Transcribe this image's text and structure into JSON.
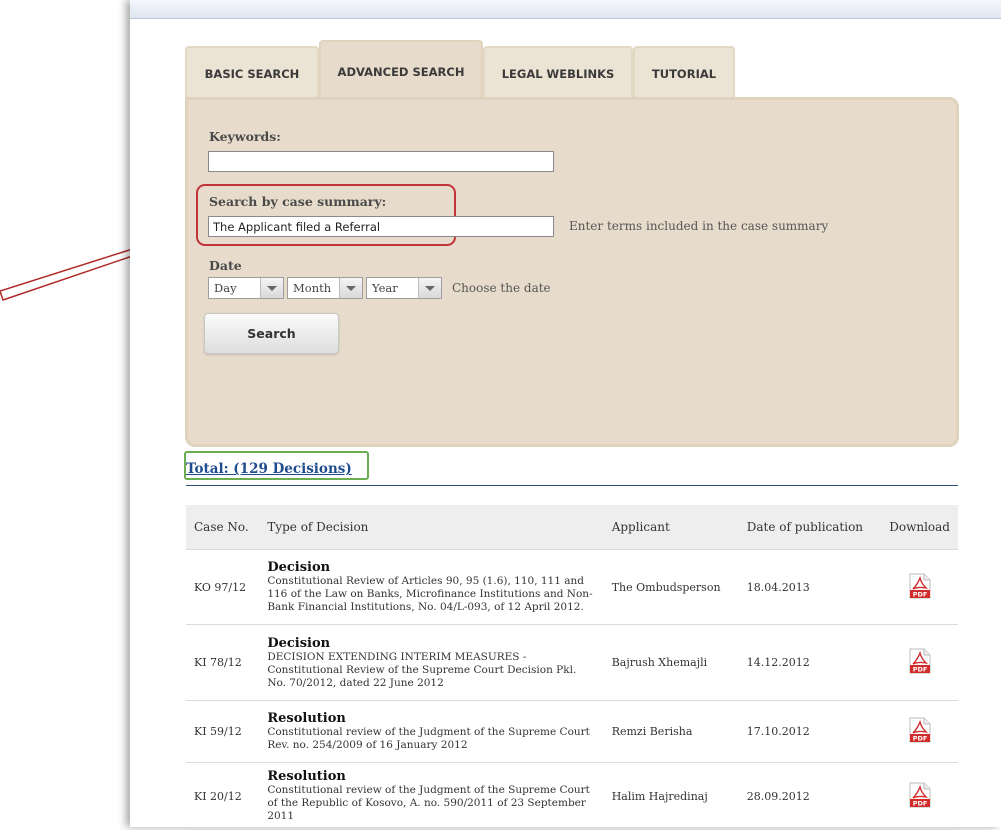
{
  "tabs": {
    "basic": "BASIC SEARCH",
    "advanced": "ADVANCED SEARCH",
    "weblinks": "LEGAL WEBLINKS",
    "tutorial": "TUTORIAL"
  },
  "form": {
    "keywords_label": "Keywords:",
    "keywords_value": "",
    "summary_label": "Search by case summary:",
    "summary_value": "The Applicant filed a Referral",
    "summary_hint": "Enter terms included in the case summary",
    "date_label": "Date",
    "day": "Day",
    "month": "Month",
    "year": "Year",
    "date_hint": "Choose the date",
    "search_button": "Search"
  },
  "results": {
    "total": "Total: (129 Decisions)",
    "columns": [
      "Case No.",
      "Type of Decision",
      "Applicant",
      "Date of publication",
      "Download"
    ],
    "rows": [
      {
        "case": "KO 97/12",
        "type": "Decision",
        "summary": "Constitutional Review of Articles 90, 95 (1.6), 110, 111 and 116 of the Law on Banks, Microfinance Institutions and Non-Bank Financial Institutions, No. 04/L-093, of 12 April 2012.",
        "applicant": "The Ombudsperson",
        "date": "18.04.2013"
      },
      {
        "case": "KI 78/12",
        "type": "Decision",
        "summary": "DECISION EXTENDING INTERIM MEASURES - Constitutional Review of the Supreme Court Decision Pkl. No. 70/2012, dated 22 June 2012",
        "applicant": "Bajrush Xhemajli",
        "date": "14.12.2012"
      },
      {
        "case": "KI 59/12",
        "type": "Resolution",
        "summary": "Constitutional review of the Judgment of the Supreme Court Rev. no. 254/2009 of 16 January 2012",
        "applicant": "Remzi Berisha",
        "date": "17.10.2012"
      },
      {
        "case": "KI 20/12",
        "type": "Resolution",
        "summary": "Constitutional review of the Judgment of the Supreme Court of the Republic of Kosovo, A. no. 590/2011 of 23 September 2011",
        "applicant": "Halim Hajredinaj",
        "date": "28.09.2012"
      }
    ],
    "pdf_label": "PDF"
  },
  "colors": {
    "panel": "#e7dccb",
    "highlight": "#c0333b",
    "total_border": "#6aae4f",
    "link": "#1f4c8f",
    "pdf_red": "#d12b2b"
  }
}
